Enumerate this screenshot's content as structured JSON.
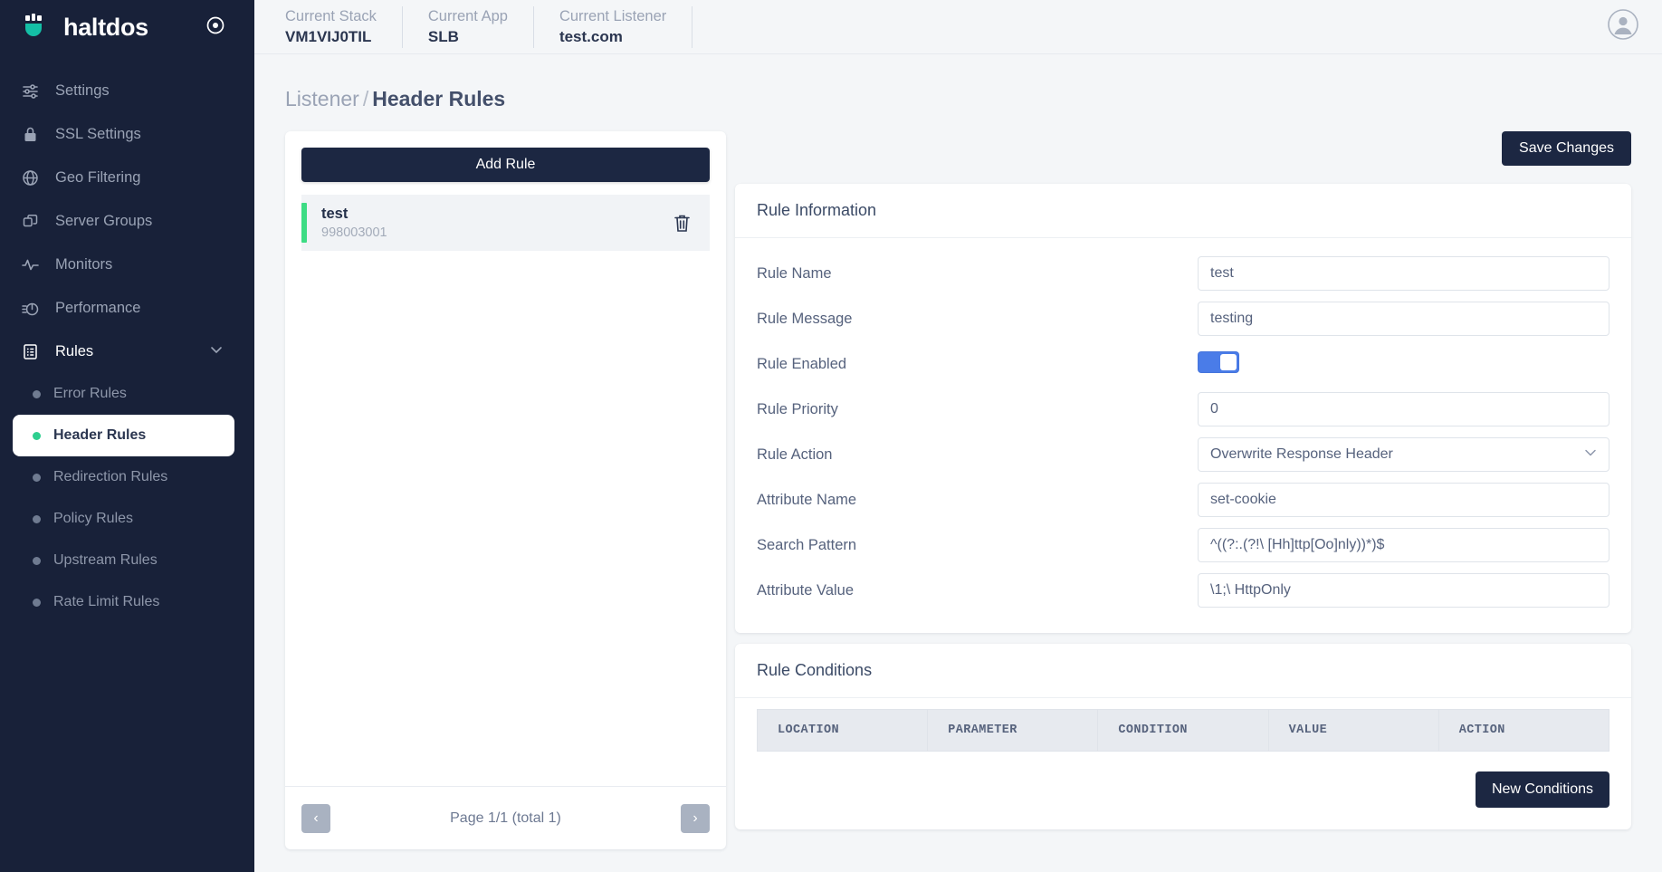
{
  "brand": {
    "name": "haltdos",
    "logo_icon": "haltdos-shield-logo",
    "target_icon": "target-icon"
  },
  "topbar": {
    "contexts": [
      {
        "label": "Current Stack",
        "value": "VM1VIJ0TIL",
        "name": "current-stack"
      },
      {
        "label": "Current App",
        "value": "SLB",
        "name": "current-app"
      },
      {
        "label": "Current Listener",
        "value": "test.com",
        "name": "current-listener"
      }
    ],
    "avatar_icon": "user-avatar-icon"
  },
  "sidebar": {
    "items": [
      {
        "label": "Settings",
        "icon": "sliders-icon"
      },
      {
        "label": "SSL Settings",
        "icon": "lock-icon"
      },
      {
        "label": "Geo Filtering",
        "icon": "globe-icon"
      },
      {
        "label": "Server Groups",
        "icon": "copy-icon"
      },
      {
        "label": "Monitors",
        "icon": "activity-icon"
      },
      {
        "label": "Performance",
        "icon": "gauge-icon"
      },
      {
        "label": "Rules",
        "icon": "list-box-icon",
        "expanded": true,
        "chevron": "chevron-down-icon"
      }
    ],
    "sub_items": [
      {
        "label": "Error Rules",
        "selected": false
      },
      {
        "label": "Header Rules",
        "selected": true
      },
      {
        "label": "Redirection Rules",
        "selected": false
      },
      {
        "label": "Policy Rules",
        "selected": false
      },
      {
        "label": "Upstream Rules",
        "selected": false
      },
      {
        "label": "Rate Limit Rules",
        "selected": false
      }
    ]
  },
  "breadcrumb": {
    "parent": "Listener",
    "separator": "/",
    "current": "Header Rules"
  },
  "rules_panel": {
    "add_rule_label": "Add Rule",
    "rules": [
      {
        "name": "test",
        "id": "998003001",
        "delete_icon": "trash-icon",
        "accent": "#3ddc84"
      }
    ],
    "pagination": {
      "prev": "‹",
      "next": "›",
      "text": "Page 1/1 (total 1)"
    }
  },
  "actions": {
    "save_changes": "Save Changes",
    "new_conditions": "New Conditions"
  },
  "rule_information": {
    "title": "Rule Information",
    "fields": [
      {
        "label": "Rule Name",
        "value": "test",
        "type": "text",
        "name": "rule-name"
      },
      {
        "label": "Rule Message",
        "value": "testing",
        "type": "text",
        "name": "rule-message"
      },
      {
        "label": "Rule Enabled",
        "value": "on",
        "type": "toggle",
        "name": "rule-enabled"
      },
      {
        "label": "Rule Priority",
        "value": "0",
        "type": "text",
        "name": "rule-priority"
      },
      {
        "label": "Rule Action",
        "value": "Overwrite Response Header",
        "type": "select",
        "name": "rule-action"
      },
      {
        "label": "Attribute Name",
        "value": "set-cookie",
        "type": "text",
        "name": "attribute-name"
      },
      {
        "label": "Search Pattern",
        "value": "^((?:.(?!\\ [Hh]ttp[Oo]nly))*)$",
        "type": "text",
        "name": "search-pattern"
      },
      {
        "label": "Attribute Value",
        "value": "\\1;\\ HttpOnly",
        "type": "text",
        "name": "attribute-value"
      }
    ]
  },
  "rule_conditions": {
    "title": "Rule Conditions",
    "columns": [
      "LOCATION",
      "PARAMETER",
      "CONDITION",
      "VALUE",
      "ACTION"
    ],
    "rows": []
  },
  "colors": {
    "sidebar_bg": "#182139",
    "accent_green": "#3ddc84",
    "toggle_blue": "#4a7ce8",
    "button_dark": "#1c2742"
  }
}
